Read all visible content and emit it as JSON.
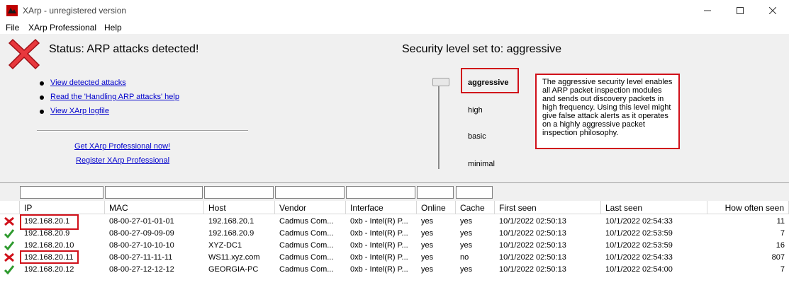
{
  "window": {
    "title": "XArp - unregistered version"
  },
  "menu": [
    "File",
    "XArp Professional",
    "Help"
  ],
  "status": {
    "text": "Status:  ARP attacks detected!"
  },
  "links": {
    "detected": "View detected attacks",
    "handling": "Read the 'Handling ARP attacks' help",
    "logfile": "View XArp logfile",
    "get_pro": "Get XArp Professional now!",
    "register": "Register XArp Professional"
  },
  "security": {
    "title": "Security level set to:  aggressive",
    "levels": [
      "aggressive",
      "high",
      "basic",
      "minimal"
    ],
    "selected": "aggressive",
    "description": "The aggressive security level enables all ARP packet inspection modules and sends out discovery packets in high frequency. Using this level might give false attack alerts as it operates on a highly aggressive packet inspection philosophy."
  },
  "table": {
    "columns": [
      "IP",
      "MAC",
      "Host",
      "Vendor",
      "Interface",
      "Online",
      "Cache",
      "First seen",
      "Last seen",
      "How often seen"
    ],
    "rows": [
      {
        "status": "attack",
        "ip": "192.168.20.1",
        "mac": "08-00-27-01-01-01",
        "host": "192.168.20.1",
        "vendor": "Cadmus Com...",
        "interface": "0xb - Intel(R) P...",
        "online": "yes",
        "cache": "yes",
        "first": "10/1/2022 02:50:13",
        "last": "10/1/2022 02:54:33",
        "count": "11"
      },
      {
        "status": "ok",
        "ip": "192.168.20.9",
        "mac": "08-00-27-09-09-09",
        "host": "192.168.20.9",
        "vendor": "Cadmus Com...",
        "interface": "0xb - Intel(R) P...",
        "online": "yes",
        "cache": "yes",
        "first": "10/1/2022 02:50:13",
        "last": "10/1/2022 02:53:59",
        "count": "7"
      },
      {
        "status": "ok",
        "ip": "192.168.20.10",
        "mac": "08-00-27-10-10-10",
        "host": "XYZ-DC1",
        "vendor": "Cadmus Com...",
        "interface": "0xb - Intel(R) P...",
        "online": "yes",
        "cache": "yes",
        "first": "10/1/2022 02:50:13",
        "last": "10/1/2022 02:53:59",
        "count": "16"
      },
      {
        "status": "attack",
        "ip": "192.168.20.11",
        "mac": "08-00-27-11-11-11",
        "host": "WS11.xyz.com",
        "vendor": "Cadmus Com...",
        "interface": "0xb - Intel(R) P...",
        "online": "yes",
        "cache": "no",
        "first": "10/1/2022 02:50:13",
        "last": "10/1/2022 02:54:33",
        "count": "807"
      },
      {
        "status": "ok",
        "ip": "192.168.20.12",
        "mac": "08-00-27-12-12-12",
        "host": "GEORGIA-PC",
        "vendor": "Cadmus Com...",
        "interface": "0xb - Intel(R) P...",
        "online": "yes",
        "cache": "yes",
        "first": "10/1/2022 02:50:13",
        "last": "10/1/2022 02:54:00",
        "count": "7"
      }
    ]
  },
  "colors": {
    "attack": "#d0101a",
    "ok": "#2e9a2e",
    "link": "#0000cc",
    "highlight": "#d0101a"
  },
  "icons": {
    "app": "xarp-app-icon",
    "status": "red-x-icon",
    "row_attack": "red-x-icon",
    "row_ok": "green-check-icon"
  }
}
